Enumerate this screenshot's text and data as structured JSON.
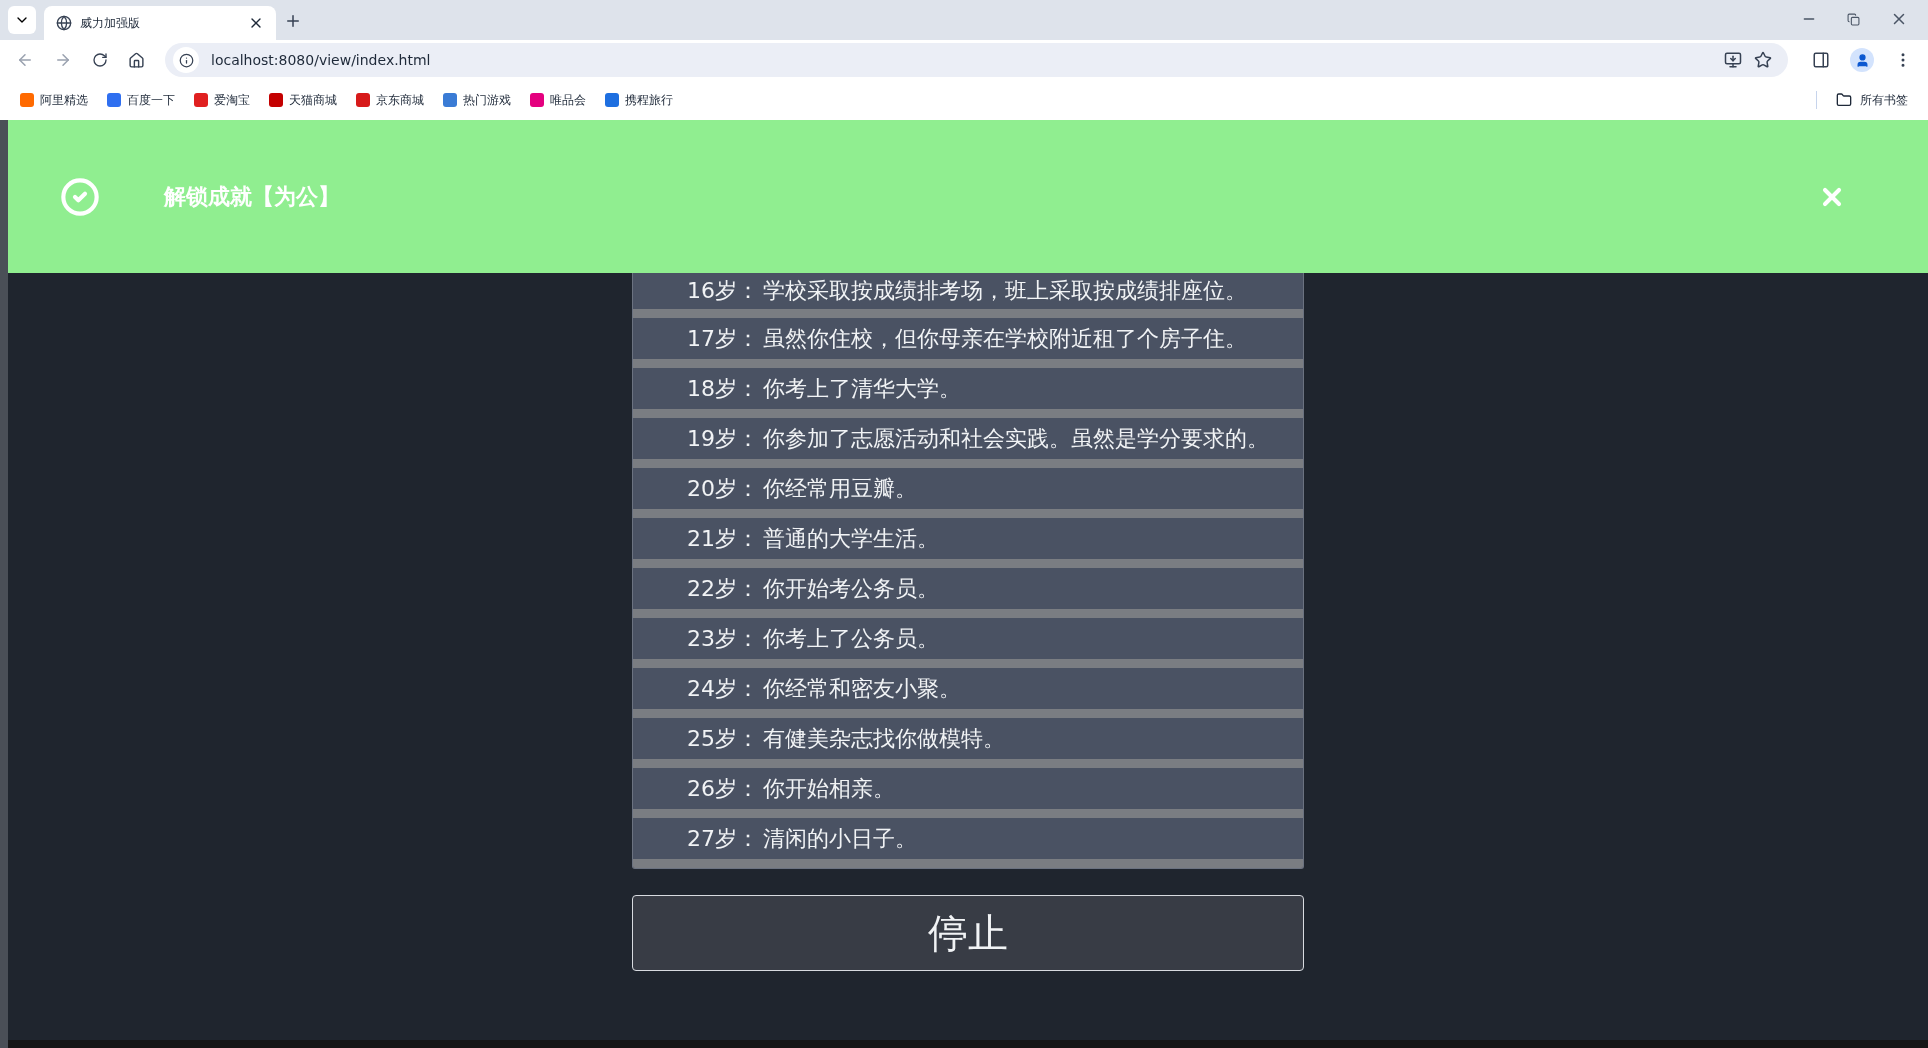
{
  "browser": {
    "tab": {
      "title": "威力加强版",
      "selected": true
    },
    "url": "localhost:8080/view/index.html",
    "bookmarks": [
      {
        "label": "阿里精选",
        "color": "#ff6a00"
      },
      {
        "label": "百度一下",
        "color": "#2f6ff0"
      },
      {
        "label": "爱淘宝",
        "color": "#e02020"
      },
      {
        "label": "天猫商城",
        "color": "#c40000"
      },
      {
        "label": "京东商城",
        "color": "#d71a1a"
      },
      {
        "label": "热门游戏",
        "color": "#3a7bd5"
      },
      {
        "label": "唯品会",
        "color": "#e4007f"
      },
      {
        "label": "携程旅行",
        "color": "#1e6fe0"
      }
    ],
    "all_bookmarks": "所有书签"
  },
  "banner": {
    "message": "解锁成就【为公】"
  },
  "events": [
    {
      "age": "16岁：",
      "text": "学校采取按成绩排考场，班上采取按成绩排座位。"
    },
    {
      "age": "17岁：",
      "text": "虽然你住校，但你母亲在学校附近租了个房子住。"
    },
    {
      "age": "18岁：",
      "text": "你考上了清华大学。"
    },
    {
      "age": "19岁：",
      "text": "你参加了志愿活动和社会实践。虽然是学分要求的。"
    },
    {
      "age": "20岁：",
      "text": "你经常用豆瓣。"
    },
    {
      "age": "21岁：",
      "text": "普通的大学生活。"
    },
    {
      "age": "22岁：",
      "text": "你开始考公务员。"
    },
    {
      "age": "23岁：",
      "text": "你考上了公务员。"
    },
    {
      "age": "24岁：",
      "text": "你经常和密友小聚。"
    },
    {
      "age": "25岁：",
      "text": "有健美杂志找你做模特。"
    },
    {
      "age": "26岁：",
      "text": "你开始相亲。"
    },
    {
      "age": "27岁：",
      "text": "清闲的小日子。"
    }
  ],
  "stop_button": "停止"
}
